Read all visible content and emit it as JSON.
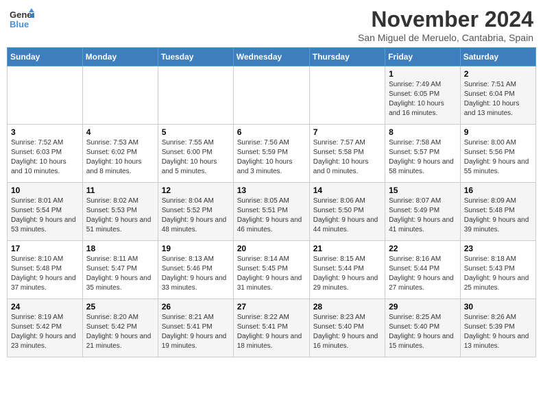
{
  "logo": {
    "line1": "General",
    "line2": "Blue"
  },
  "title": {
    "month": "November 2024",
    "location": "San Miguel de Meruelo, Cantabria, Spain"
  },
  "weekdays": [
    "Sunday",
    "Monday",
    "Tuesday",
    "Wednesday",
    "Thursday",
    "Friday",
    "Saturday"
  ],
  "weeks": [
    [
      {
        "day": "",
        "info": ""
      },
      {
        "day": "",
        "info": ""
      },
      {
        "day": "",
        "info": ""
      },
      {
        "day": "",
        "info": ""
      },
      {
        "day": "",
        "info": ""
      },
      {
        "day": "1",
        "info": "Sunrise: 7:49 AM\nSunset: 6:05 PM\nDaylight: 10 hours and 16 minutes."
      },
      {
        "day": "2",
        "info": "Sunrise: 7:51 AM\nSunset: 6:04 PM\nDaylight: 10 hours and 13 minutes."
      }
    ],
    [
      {
        "day": "3",
        "info": "Sunrise: 7:52 AM\nSunset: 6:03 PM\nDaylight: 10 hours and 10 minutes."
      },
      {
        "day": "4",
        "info": "Sunrise: 7:53 AM\nSunset: 6:02 PM\nDaylight: 10 hours and 8 minutes."
      },
      {
        "day": "5",
        "info": "Sunrise: 7:55 AM\nSunset: 6:00 PM\nDaylight: 10 hours and 5 minutes."
      },
      {
        "day": "6",
        "info": "Sunrise: 7:56 AM\nSunset: 5:59 PM\nDaylight: 10 hours and 3 minutes."
      },
      {
        "day": "7",
        "info": "Sunrise: 7:57 AM\nSunset: 5:58 PM\nDaylight: 10 hours and 0 minutes."
      },
      {
        "day": "8",
        "info": "Sunrise: 7:58 AM\nSunset: 5:57 PM\nDaylight: 9 hours and 58 minutes."
      },
      {
        "day": "9",
        "info": "Sunrise: 8:00 AM\nSunset: 5:56 PM\nDaylight: 9 hours and 55 minutes."
      }
    ],
    [
      {
        "day": "10",
        "info": "Sunrise: 8:01 AM\nSunset: 5:54 PM\nDaylight: 9 hours and 53 minutes."
      },
      {
        "day": "11",
        "info": "Sunrise: 8:02 AM\nSunset: 5:53 PM\nDaylight: 9 hours and 51 minutes."
      },
      {
        "day": "12",
        "info": "Sunrise: 8:04 AM\nSunset: 5:52 PM\nDaylight: 9 hours and 48 minutes."
      },
      {
        "day": "13",
        "info": "Sunrise: 8:05 AM\nSunset: 5:51 PM\nDaylight: 9 hours and 46 minutes."
      },
      {
        "day": "14",
        "info": "Sunrise: 8:06 AM\nSunset: 5:50 PM\nDaylight: 9 hours and 44 minutes."
      },
      {
        "day": "15",
        "info": "Sunrise: 8:07 AM\nSunset: 5:49 PM\nDaylight: 9 hours and 41 minutes."
      },
      {
        "day": "16",
        "info": "Sunrise: 8:09 AM\nSunset: 5:48 PM\nDaylight: 9 hours and 39 minutes."
      }
    ],
    [
      {
        "day": "17",
        "info": "Sunrise: 8:10 AM\nSunset: 5:48 PM\nDaylight: 9 hours and 37 minutes."
      },
      {
        "day": "18",
        "info": "Sunrise: 8:11 AM\nSunset: 5:47 PM\nDaylight: 9 hours and 35 minutes."
      },
      {
        "day": "19",
        "info": "Sunrise: 8:13 AM\nSunset: 5:46 PM\nDaylight: 9 hours and 33 minutes."
      },
      {
        "day": "20",
        "info": "Sunrise: 8:14 AM\nSunset: 5:45 PM\nDaylight: 9 hours and 31 minutes."
      },
      {
        "day": "21",
        "info": "Sunrise: 8:15 AM\nSunset: 5:44 PM\nDaylight: 9 hours and 29 minutes."
      },
      {
        "day": "22",
        "info": "Sunrise: 8:16 AM\nSunset: 5:44 PM\nDaylight: 9 hours and 27 minutes."
      },
      {
        "day": "23",
        "info": "Sunrise: 8:18 AM\nSunset: 5:43 PM\nDaylight: 9 hours and 25 minutes."
      }
    ],
    [
      {
        "day": "24",
        "info": "Sunrise: 8:19 AM\nSunset: 5:42 PM\nDaylight: 9 hours and 23 minutes."
      },
      {
        "day": "25",
        "info": "Sunrise: 8:20 AM\nSunset: 5:42 PM\nDaylight: 9 hours and 21 minutes."
      },
      {
        "day": "26",
        "info": "Sunrise: 8:21 AM\nSunset: 5:41 PM\nDaylight: 9 hours and 19 minutes."
      },
      {
        "day": "27",
        "info": "Sunrise: 8:22 AM\nSunset: 5:41 PM\nDaylight: 9 hours and 18 minutes."
      },
      {
        "day": "28",
        "info": "Sunrise: 8:23 AM\nSunset: 5:40 PM\nDaylight: 9 hours and 16 minutes."
      },
      {
        "day": "29",
        "info": "Sunrise: 8:25 AM\nSunset: 5:40 PM\nDaylight: 9 hours and 15 minutes."
      },
      {
        "day": "30",
        "info": "Sunrise: 8:26 AM\nSunset: 5:39 PM\nDaylight: 9 hours and 13 minutes."
      }
    ]
  ]
}
